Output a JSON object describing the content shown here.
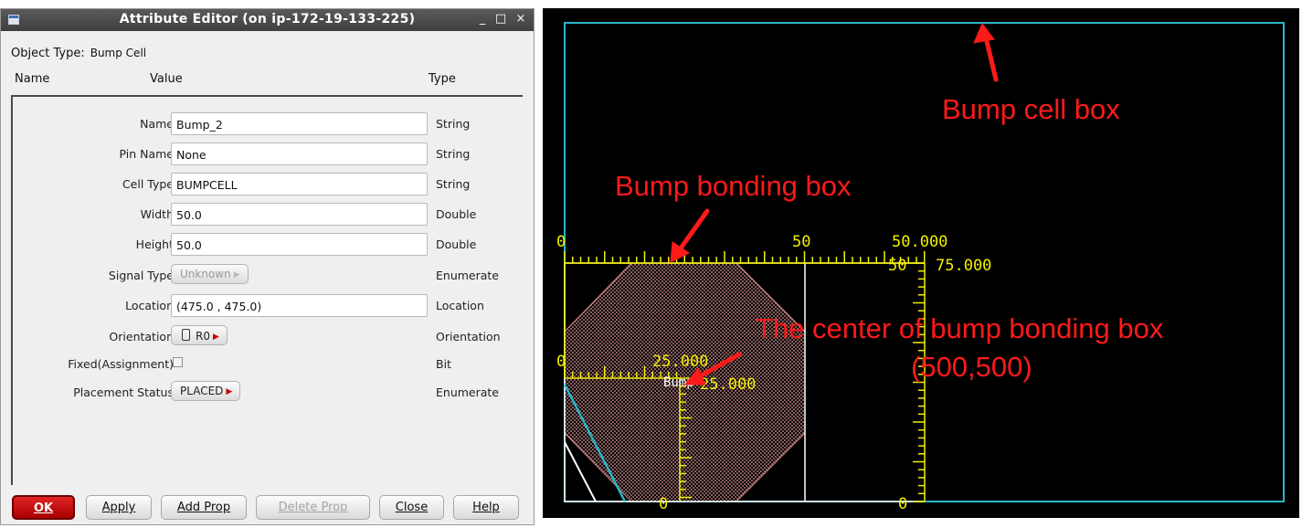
{
  "window": {
    "title": "Attribute Editor (on ip-172-19-133-225)",
    "minimize_glyph": "_",
    "maximize_glyph": "□",
    "close_glyph": "×"
  },
  "object_type": {
    "label": "Object Type:",
    "value": "Bump Cell"
  },
  "columns": {
    "name": "Name",
    "value": "Value",
    "type": "Type"
  },
  "attributes": [
    {
      "name": "Name",
      "value": "Bump_2",
      "type": "String",
      "kind": "text"
    },
    {
      "name": "Pin Name",
      "value": "None",
      "type": "String",
      "kind": "text"
    },
    {
      "name": "Cell Type",
      "value": "BUMPCELL",
      "type": "String",
      "kind": "text"
    },
    {
      "name": "Width",
      "value": "50.0",
      "type": "Double",
      "kind": "text"
    },
    {
      "name": "Height",
      "value": "50.0",
      "type": "Double",
      "kind": "text"
    },
    {
      "name": "Signal Type",
      "value": "Unknown",
      "type": "Enumerate",
      "kind": "menu-disabled"
    },
    {
      "name": "Location",
      "value": "(475.0 , 475.0)",
      "type": "Location",
      "kind": "text"
    },
    {
      "name": "Orientation",
      "value": "R0",
      "type": "Orientation",
      "kind": "menu-icon"
    },
    {
      "name": "Fixed(Assignment)",
      "value": "",
      "type": "Bit",
      "kind": "checkbox",
      "checked": false
    },
    {
      "name": "Placement Status",
      "value": "PLACED",
      "type": "Enumerate",
      "kind": "menu"
    }
  ],
  "buttons": {
    "ok": "OK",
    "apply": "Apply",
    "add_prop": "Add Prop",
    "delete_prop": "Delete Prop",
    "close": "Close",
    "help": "Help"
  },
  "layout_view": {
    "ruler_labels": {
      "top_left_zero": "0",
      "top_fifty": "50",
      "top_fifty_k": "50.000",
      "top_seventyfive_k": "75.000",
      "right_fifty": "50",
      "mid_zero": "0",
      "mid_twentyfive_k": "25.000",
      "mid_twentyfive_k_right": "25.000",
      "bump_label": "Bump",
      "bottom_zero_left": "0",
      "bottom_zero_right": "0"
    },
    "annotations": {
      "bump_cell_box": "Bump cell box",
      "bump_bonding_box": "Bump bonding box",
      "center_line1": "The center of bump bonding box",
      "center_line2": "(500,500)"
    },
    "colors": {
      "background": "#000000",
      "cell_box": "#2ab5c8",
      "ruler": "#f3f000",
      "annotation": "#ff1a1a",
      "bond_fill": "#e8a0a0"
    }
  }
}
